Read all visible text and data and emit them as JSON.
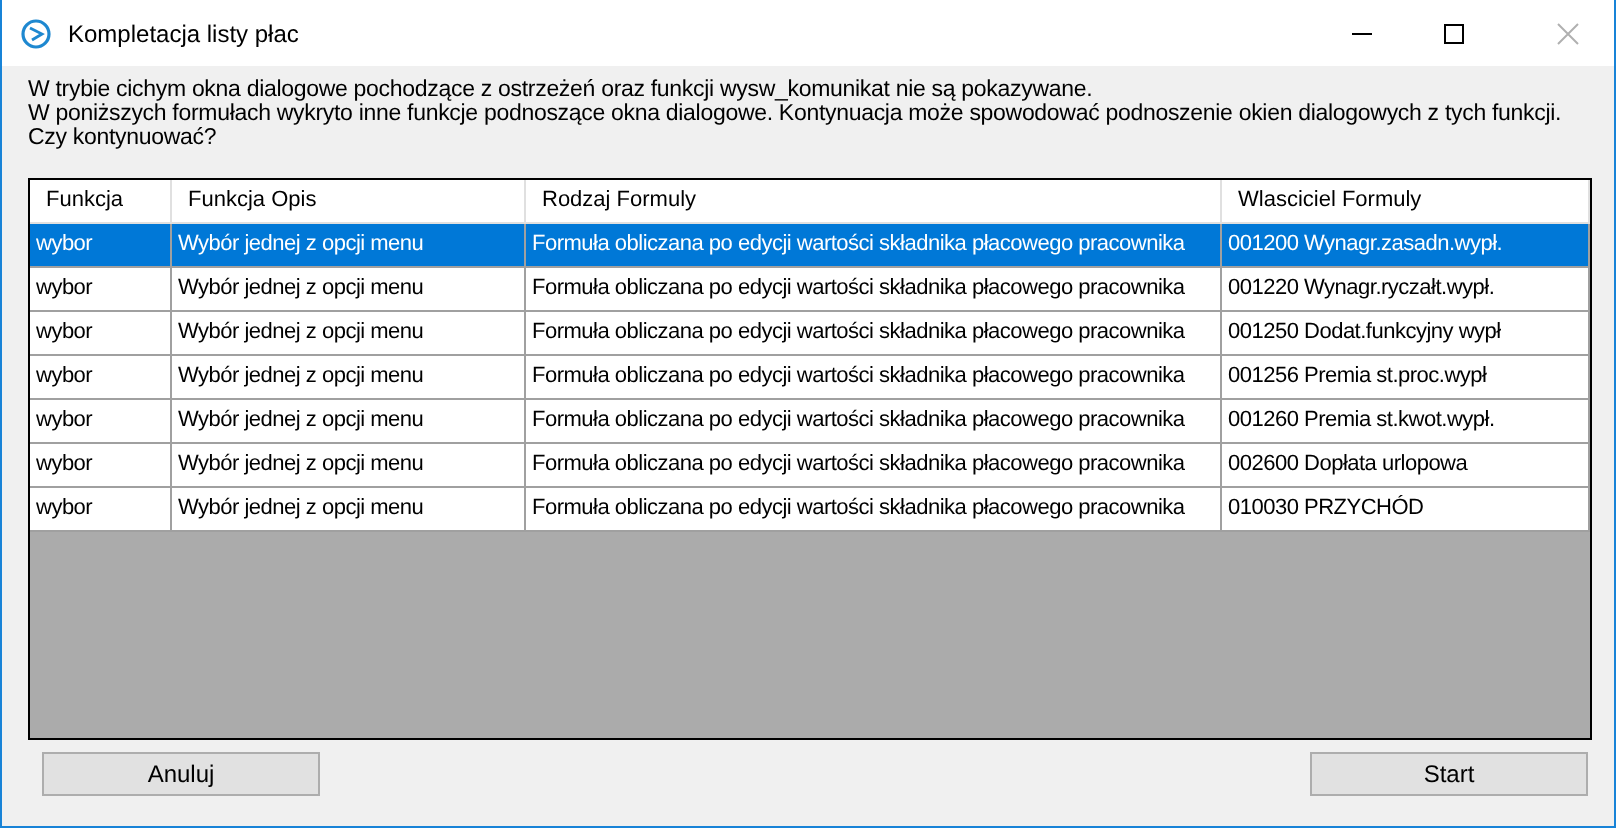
{
  "window": {
    "title": "Kompletacja listy płac"
  },
  "message": [
    "W trybie cichym okna dialogowe pochodzące z ostrzeżeń oraz funkcji wysw_komunikat nie są pokazywane.",
    "W poniższych formułach wykryto inne funkcje podnoszące okna dialogowe. Kontynuacja może spowodować podnoszenie okien dialogowych z tych funkcji.",
    "Czy kontynuować?"
  ],
  "table": {
    "columns": [
      "Funkcja",
      "Funkcja Opis",
      "Rodzaj Formuly",
      "Wlasciciel Formuly"
    ],
    "rows": [
      {
        "selected": true,
        "cells": [
          "wybor",
          "Wybór jednej z opcji menu",
          "Formuła obliczana po edycji wartości składnika płacowego pracownika",
          "001200 Wynagr.zasadn.wypł."
        ]
      },
      {
        "selected": false,
        "cells": [
          "wybor",
          "Wybór jednej z opcji menu",
          "Formuła obliczana po edycji wartości składnika płacowego pracownika",
          "001220 Wynagr.ryczałt.wypł."
        ]
      },
      {
        "selected": false,
        "cells": [
          "wybor",
          "Wybór jednej z opcji menu",
          "Formuła obliczana po edycji wartości składnika płacowego pracownika",
          "001250 Dodat.funkcyjny wypł"
        ]
      },
      {
        "selected": false,
        "cells": [
          "wybor",
          "Wybór jednej z opcji menu",
          "Formuła obliczana po edycji wartości składnika płacowego pracownika",
          "001256 Premia st.proc.wypł"
        ]
      },
      {
        "selected": false,
        "cells": [
          "wybor",
          "Wybór jednej z opcji menu",
          "Formuła obliczana po edycji wartości składnika płacowego pracownika",
          "001260 Premia st.kwot.wypł."
        ]
      },
      {
        "selected": false,
        "cells": [
          "wybor",
          "Wybór jednej z opcji menu",
          "Formuła obliczana po edycji wartości składnika płacowego pracownika",
          "002600 Dopłata urlopowa"
        ]
      },
      {
        "selected": false,
        "cells": [
          "wybor",
          "Wybór jednej z opcji menu",
          "Formuła obliczana po edycji wartości składnika płacowego pracownika",
          "010030 PRZYCHÓD"
        ]
      }
    ]
  },
  "buttons": {
    "cancel": "Anuluj",
    "start": "Start"
  }
}
